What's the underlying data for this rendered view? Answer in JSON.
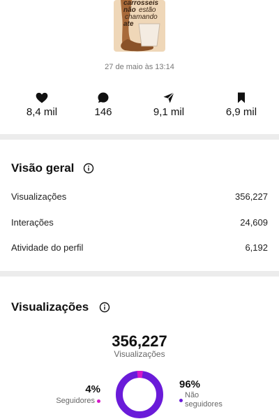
{
  "post": {
    "thumbnail_lines": [
      "carrosseis",
      "não",
      "estão",
      "chamando",
      "ate"
    ],
    "date": "27 de maio às 13:14"
  },
  "stats": [
    {
      "icon": "heart-icon",
      "value": "8,4 mil"
    },
    {
      "icon": "comment-icon",
      "value": "146"
    },
    {
      "icon": "share-icon",
      "value": "9,1 mil"
    },
    {
      "icon": "bookmark-icon",
      "value": "6,9 mil"
    }
  ],
  "overview": {
    "title": "Visão geral",
    "rows": [
      {
        "label": "Visualizações",
        "value": "356,227"
      },
      {
        "label": "Interações",
        "value": "24,609"
      },
      {
        "label": "Atividade do perfil",
        "value": "6,192"
      }
    ]
  },
  "views": {
    "title": "Visualizações",
    "total": "356,227",
    "total_label": "Visualizações",
    "followers_pct": "4%",
    "followers_label": "Seguidores",
    "followers_fraction": 0.04,
    "non_followers_pct": "96%",
    "non_followers_label": "Não seguidores",
    "colors": {
      "followers": "#d418c8",
      "non_followers": "#6a1bd9"
    }
  }
}
